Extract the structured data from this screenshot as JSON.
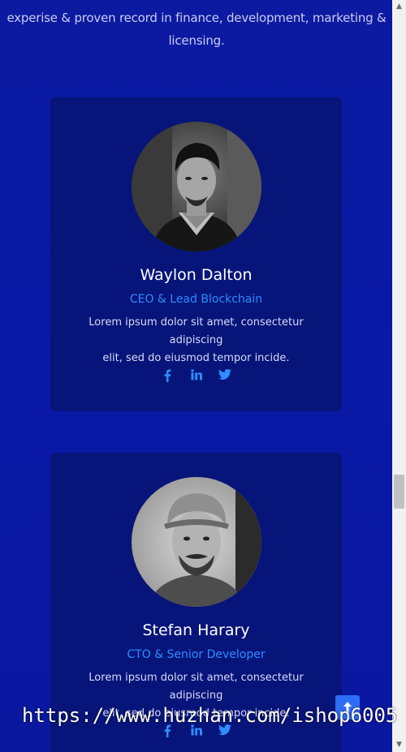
{
  "intro": {
    "line1": "expertise & proven record in finance, development, marketing &",
    "line1_display": "experise & proven record in finance, development, marketing &",
    "line2": "licensing."
  },
  "team": [
    {
      "name": "Waylon Dalton",
      "role": "CEO & Lead Blockchain",
      "bio_line1": "Lorem ipsum dolor sit amet, consectetur adipiscing",
      "bio_line2": "elit, sed do eiusmod tempor incide.",
      "socials": [
        "facebook-icon",
        "linkedin-icon",
        "twitter-icon"
      ]
    },
    {
      "name": "Stefan Harary",
      "role": "CTO & Senior Developer",
      "bio_line1": "Lorem ipsum dolor sit amet, consectetur adipiscing",
      "bio_line2": "elit, sed do eiusmod tempor incide.",
      "socials": [
        "facebook-icon",
        "linkedin-icon",
        "twitter-icon"
      ]
    }
  ],
  "watermark": "https://www.huzhan.com/ishop6005",
  "colors": {
    "background": "#0a19a6",
    "card": "#07157a",
    "accent": "#2e8cff",
    "back_to_top": "#2e6df5"
  }
}
